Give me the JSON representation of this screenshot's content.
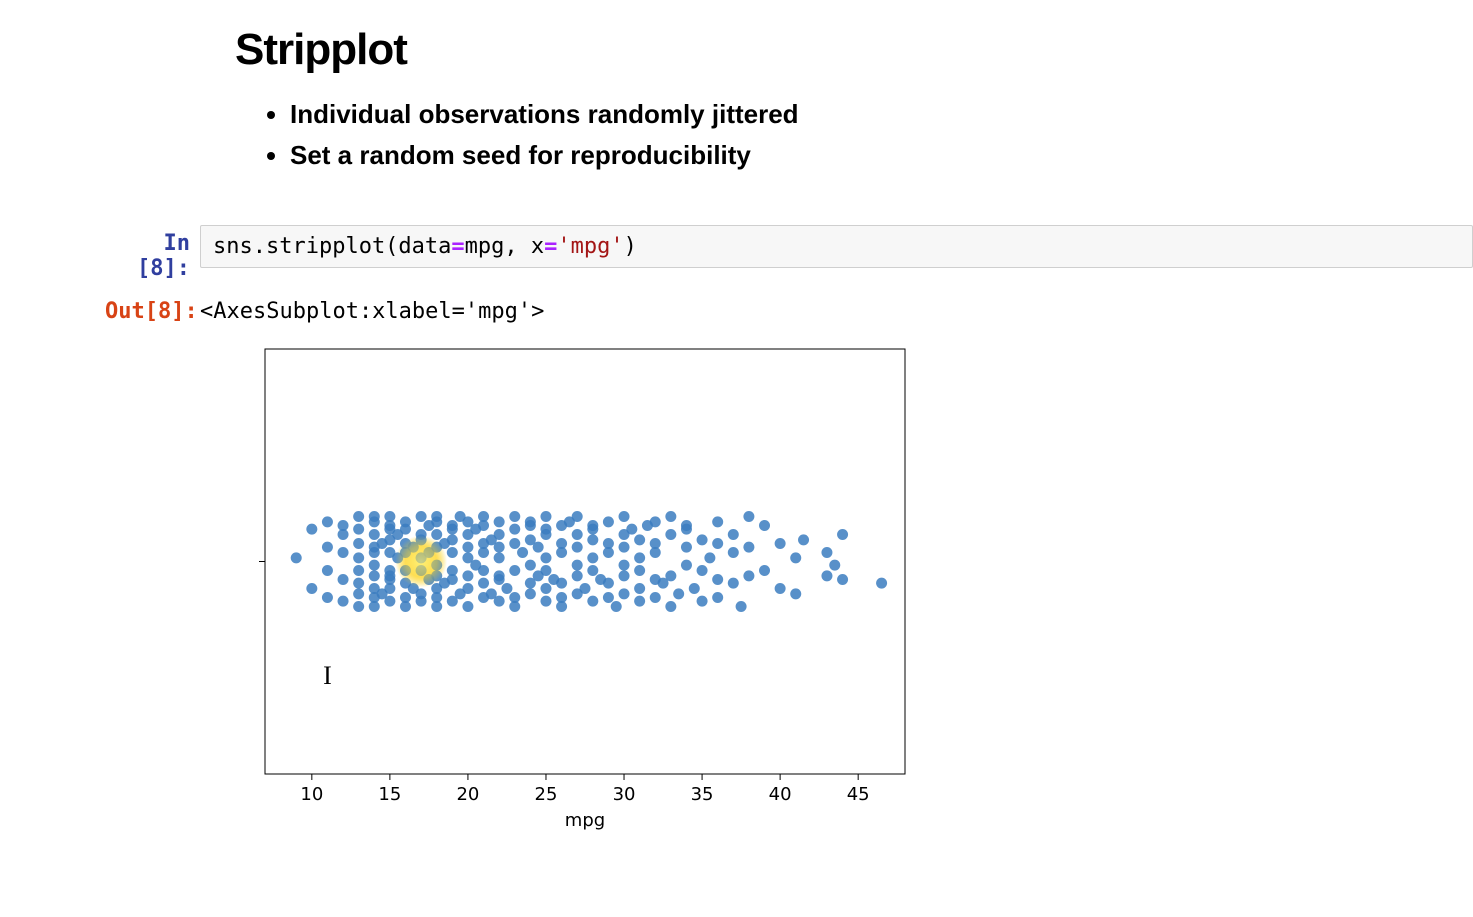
{
  "heading": "Stripplot",
  "bullets": [
    "Individual observations randomly jittered",
    "Set a random seed for reproducibility"
  ],
  "cell": {
    "in_prompt": "In [8]:",
    "out_prompt": "Out[8]:",
    "code_prefix": "sns.stripplot(data",
    "code_eq1": "=",
    "code_mid": "mpg, x",
    "code_eq2": "=",
    "code_str": "'mpg'",
    "code_suffix": ")",
    "output_text": "<AxesSubplot:xlabel='mpg'>"
  },
  "chart_data": {
    "type": "scatter",
    "title": "",
    "xlabel": "mpg",
    "ylabel": "",
    "xlim": [
      7,
      48
    ],
    "ylim": [
      -0.5,
      0.5
    ],
    "xticks": [
      10,
      15,
      20,
      25,
      30,
      35,
      40,
      45
    ],
    "highlight_point": {
      "x": 17,
      "y": 0.0
    },
    "series": [
      {
        "name": "mpg",
        "points": [
          {
            "x": 9,
            "y": 0.02
          },
          {
            "x": 10,
            "y": -0.15
          },
          {
            "x": 10,
            "y": 0.18
          },
          {
            "x": 11,
            "y": 0.22
          },
          {
            "x": 11,
            "y": -0.05
          },
          {
            "x": 11,
            "y": -0.2
          },
          {
            "x": 11,
            "y": 0.08
          },
          {
            "x": 12,
            "y": 0.2
          },
          {
            "x": 12,
            "y": -0.1
          },
          {
            "x": 12,
            "y": 0.05
          },
          {
            "x": 12,
            "y": -0.22
          },
          {
            "x": 12,
            "y": 0.15
          },
          {
            "x": 13,
            "y": 0.25
          },
          {
            "x": 13,
            "y": -0.18
          },
          {
            "x": 13,
            "y": 0.1
          },
          {
            "x": 13,
            "y": -0.05
          },
          {
            "x": 13,
            "y": 0.18
          },
          {
            "x": 13,
            "y": -0.25
          },
          {
            "x": 13,
            "y": 0.02
          },
          {
            "x": 13,
            "y": -0.12
          },
          {
            "x": 14,
            "y": 0.22
          },
          {
            "x": 14,
            "y": -0.2
          },
          {
            "x": 14,
            "y": 0.08
          },
          {
            "x": 14,
            "y": -0.08
          },
          {
            "x": 14,
            "y": 0.15
          },
          {
            "x": 14,
            "y": -0.15
          },
          {
            "x": 14,
            "y": 0.25
          },
          {
            "x": 14,
            "y": -0.02
          },
          {
            "x": 14,
            "y": 0.05
          },
          {
            "x": 14,
            "y": -0.25
          },
          {
            "x": 14.5,
            "y": 0.1
          },
          {
            "x": 14.5,
            "y": -0.18
          },
          {
            "x": 15,
            "y": 0.2
          },
          {
            "x": 15,
            "y": -0.1
          },
          {
            "x": 15,
            "y": 0.05
          },
          {
            "x": 15,
            "y": -0.22
          },
          {
            "x": 15,
            "y": 0.12
          },
          {
            "x": 15,
            "y": -0.05
          },
          {
            "x": 15,
            "y": 0.25
          },
          {
            "x": 15,
            "y": -0.15
          },
          {
            "x": 15,
            "y": 0.18
          },
          {
            "x": 15,
            "y": -0.08
          },
          {
            "x": 15.5,
            "y": 0.02
          },
          {
            "x": 15.5,
            "y": 0.15
          },
          {
            "x": 16,
            "y": 0.22
          },
          {
            "x": 16,
            "y": -0.2
          },
          {
            "x": 16,
            "y": 0.1
          },
          {
            "x": 16,
            "y": -0.12
          },
          {
            "x": 16,
            "y": 0.05
          },
          {
            "x": 16,
            "y": -0.05
          },
          {
            "x": 16,
            "y": 0.18
          },
          {
            "x": 16,
            "y": -0.25
          },
          {
            "x": 16.5,
            "y": 0.08
          },
          {
            "x": 16.5,
            "y": -0.15
          },
          {
            "x": 17,
            "y": 0.25
          },
          {
            "x": 17,
            "y": -0.18
          },
          {
            "x": 17,
            "y": 0.12
          },
          {
            "x": 17,
            "y": -0.05
          },
          {
            "x": 17,
            "y": 0.02
          },
          {
            "x": 17,
            "y": -0.22
          },
          {
            "x": 17,
            "y": 0.15
          },
          {
            "x": 17.5,
            "y": -0.1
          },
          {
            "x": 17.5,
            "y": 0.2
          },
          {
            "x": 17.5,
            "y": 0.05
          },
          {
            "x": 18,
            "y": 0.22
          },
          {
            "x": 18,
            "y": -0.2
          },
          {
            "x": 18,
            "y": 0.08
          },
          {
            "x": 18,
            "y": -0.08
          },
          {
            "x": 18,
            "y": 0.15
          },
          {
            "x": 18,
            "y": -0.15
          },
          {
            "x": 18,
            "y": 0.25
          },
          {
            "x": 18,
            "y": -0.02
          },
          {
            "x": 18,
            "y": -0.25
          },
          {
            "x": 18.5,
            "y": 0.1
          },
          {
            "x": 18.5,
            "y": -0.12
          },
          {
            "x": 19,
            "y": 0.2
          },
          {
            "x": 19,
            "y": -0.1
          },
          {
            "x": 19,
            "y": 0.05
          },
          {
            "x": 19,
            "y": -0.22
          },
          {
            "x": 19,
            "y": 0.18
          },
          {
            "x": 19,
            "y": -0.05
          },
          {
            "x": 19,
            "y": 0.12
          },
          {
            "x": 19.5,
            "y": -0.18
          },
          {
            "x": 19.5,
            "y": 0.25
          },
          {
            "x": 20,
            "y": 0.22
          },
          {
            "x": 20,
            "y": -0.15
          },
          {
            "x": 20,
            "y": 0.08
          },
          {
            "x": 20,
            "y": -0.08
          },
          {
            "x": 20,
            "y": 0.02
          },
          {
            "x": 20,
            "y": -0.25
          },
          {
            "x": 20,
            "y": 0.15
          },
          {
            "x": 20.5,
            "y": -0.02
          },
          {
            "x": 20.5,
            "y": 0.18
          },
          {
            "x": 21,
            "y": 0.2
          },
          {
            "x": 21,
            "y": -0.12
          },
          {
            "x": 21,
            "y": 0.05
          },
          {
            "x": 21,
            "y": -0.2
          },
          {
            "x": 21,
            "y": 0.1
          },
          {
            "x": 21,
            "y": -0.05
          },
          {
            "x": 21,
            "y": 0.25
          },
          {
            "x": 21.5,
            "y": -0.18
          },
          {
            "x": 21.5,
            "y": 0.12
          },
          {
            "x": 22,
            "y": 0.22
          },
          {
            "x": 22,
            "y": -0.1
          },
          {
            "x": 22,
            "y": 0.08
          },
          {
            "x": 22,
            "y": -0.22
          },
          {
            "x": 22,
            "y": 0.15
          },
          {
            "x": 22,
            "y": -0.08
          },
          {
            "x": 22,
            "y": 0.02
          },
          {
            "x": 22.5,
            "y": -0.15
          },
          {
            "x": 23,
            "y": 0.18
          },
          {
            "x": 23,
            "y": -0.05
          },
          {
            "x": 23,
            "y": 0.25
          },
          {
            "x": 23,
            "y": -0.2
          },
          {
            "x": 23,
            "y": 0.1
          },
          {
            "x": 23,
            "y": -0.25
          },
          {
            "x": 23.5,
            "y": 0.05
          },
          {
            "x": 24,
            "y": 0.2
          },
          {
            "x": 24,
            "y": -0.12
          },
          {
            "x": 24,
            "y": 0.12
          },
          {
            "x": 24,
            "y": -0.02
          },
          {
            "x": 24,
            "y": -0.18
          },
          {
            "x": 24,
            "y": 0.22
          },
          {
            "x": 24.5,
            "y": 0.08
          },
          {
            "x": 24.5,
            "y": -0.08
          },
          {
            "x": 25,
            "y": 0.15
          },
          {
            "x": 25,
            "y": -0.15
          },
          {
            "x": 25,
            "y": 0.25
          },
          {
            "x": 25,
            "y": -0.05
          },
          {
            "x": 25,
            "y": 0.02
          },
          {
            "x": 25,
            "y": -0.22
          },
          {
            "x": 25,
            "y": 0.18
          },
          {
            "x": 25.5,
            "y": -0.1
          },
          {
            "x": 26,
            "y": 0.2
          },
          {
            "x": 26,
            "y": -0.2
          },
          {
            "x": 26,
            "y": 0.1
          },
          {
            "x": 26,
            "y": -0.12
          },
          {
            "x": 26,
            "y": 0.05
          },
          {
            "x": 26,
            "y": -0.25
          },
          {
            "x": 26.5,
            "y": 0.22
          },
          {
            "x": 27,
            "y": -0.08
          },
          {
            "x": 27,
            "y": 0.15
          },
          {
            "x": 27,
            "y": -0.18
          },
          {
            "x": 27,
            "y": 0.08
          },
          {
            "x": 27,
            "y": 0.25
          },
          {
            "x": 27,
            "y": -0.02
          },
          {
            "x": 27.5,
            "y": -0.15
          },
          {
            "x": 28,
            "y": 0.12
          },
          {
            "x": 28,
            "y": -0.05
          },
          {
            "x": 28,
            "y": 0.18
          },
          {
            "x": 28,
            "y": -0.22
          },
          {
            "x": 28,
            "y": 0.02
          },
          {
            "x": 28,
            "y": 0.2
          },
          {
            "x": 28.5,
            "y": -0.1
          },
          {
            "x": 29,
            "y": 0.22
          },
          {
            "x": 29,
            "y": -0.2
          },
          {
            "x": 29,
            "y": 0.1
          },
          {
            "x": 29,
            "y": -0.12
          },
          {
            "x": 29,
            "y": 0.05
          },
          {
            "x": 29.5,
            "y": -0.25
          },
          {
            "x": 30,
            "y": 0.15
          },
          {
            "x": 30,
            "y": -0.08
          },
          {
            "x": 30,
            "y": 0.25
          },
          {
            "x": 30,
            "y": -0.18
          },
          {
            "x": 30,
            "y": 0.08
          },
          {
            "x": 30,
            "y": -0.02
          },
          {
            "x": 30.5,
            "y": 0.18
          },
          {
            "x": 31,
            "y": -0.15
          },
          {
            "x": 31,
            "y": 0.12
          },
          {
            "x": 31,
            "y": -0.05
          },
          {
            "x": 31,
            "y": 0.02
          },
          {
            "x": 31,
            "y": -0.22
          },
          {
            "x": 31.5,
            "y": 0.2
          },
          {
            "x": 32,
            "y": -0.1
          },
          {
            "x": 32,
            "y": 0.22
          },
          {
            "x": 32,
            "y": -0.2
          },
          {
            "x": 32,
            "y": 0.1
          },
          {
            "x": 32,
            "y": 0.05
          },
          {
            "x": 32.5,
            "y": -0.12
          },
          {
            "x": 33,
            "y": 0.15
          },
          {
            "x": 33,
            "y": -0.08
          },
          {
            "x": 33,
            "y": 0.25
          },
          {
            "x": 33,
            "y": -0.25
          },
          {
            "x": 33.5,
            "y": -0.18
          },
          {
            "x": 34,
            "y": 0.08
          },
          {
            "x": 34,
            "y": -0.02
          },
          {
            "x": 34,
            "y": 0.18
          },
          {
            "x": 34,
            "y": 0.2
          },
          {
            "x": 34.5,
            "y": -0.15
          },
          {
            "x": 35,
            "y": 0.12
          },
          {
            "x": 35,
            "y": -0.05
          },
          {
            "x": 35,
            "y": -0.22
          },
          {
            "x": 35.5,
            "y": 0.02
          },
          {
            "x": 36,
            "y": 0.22
          },
          {
            "x": 36,
            "y": -0.1
          },
          {
            "x": 36,
            "y": 0.1
          },
          {
            "x": 36,
            "y": -0.2
          },
          {
            "x": 37,
            "y": 0.05
          },
          {
            "x": 37,
            "y": -0.12
          },
          {
            "x": 37,
            "y": 0.15
          },
          {
            "x": 37.5,
            "y": -0.25
          },
          {
            "x": 38,
            "y": -0.08
          },
          {
            "x": 38,
            "y": 0.25
          },
          {
            "x": 38,
            "y": 0.08
          },
          {
            "x": 39,
            "y": 0.2
          },
          {
            "x": 39,
            "y": -0.05
          },
          {
            "x": 40,
            "y": -0.15
          },
          {
            "x": 40,
            "y": 0.1
          },
          {
            "x": 41,
            "y": 0.02
          },
          {
            "x": 41,
            "y": -0.18
          },
          {
            "x": 41.5,
            "y": 0.12
          },
          {
            "x": 43,
            "y": 0.05
          },
          {
            "x": 43,
            "y": -0.08
          },
          {
            "x": 43.5,
            "y": -0.02
          },
          {
            "x": 44,
            "y": 0.15
          },
          {
            "x": 44,
            "y": -0.1
          },
          {
            "x": 46.5,
            "y": -0.12
          }
        ]
      }
    ]
  }
}
